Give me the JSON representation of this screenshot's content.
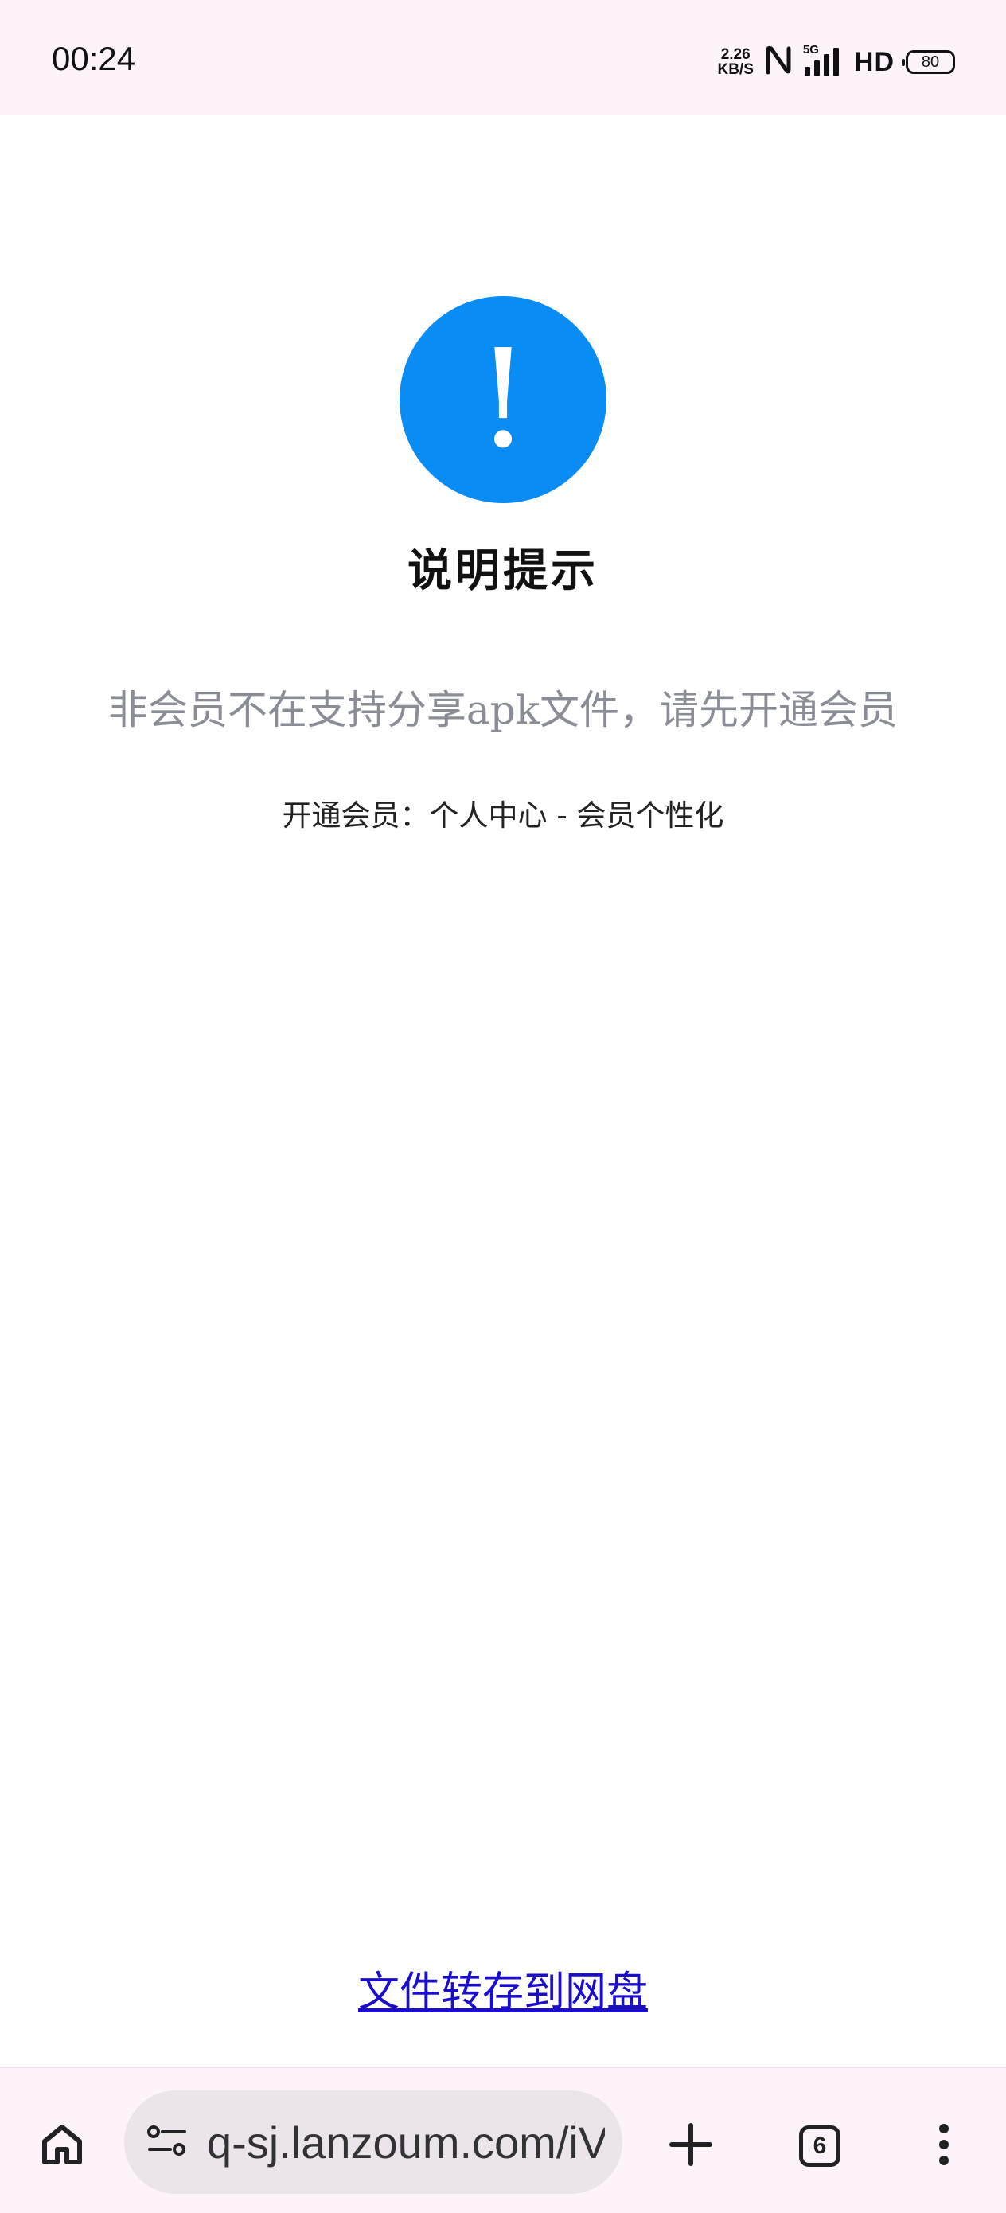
{
  "status_bar": {
    "time": "00:24",
    "net_speed_value": "2.26",
    "net_speed_unit": "KB/S",
    "network_label": "5G",
    "hd_label": "HD",
    "battery": "80"
  },
  "notice": {
    "icon_glyph": "!",
    "icon_color": "#0a8cf5",
    "title": "说明提示",
    "message": "非会员不在支持分享apk文件，请先开通会员",
    "sub_message": "开通会员：个人中心 - 会员个性化",
    "save_link_label": "文件转存到网盘"
  },
  "browser": {
    "url": "q-sj.lanzoum.com/iV",
    "tab_count": "6",
    "icons": [
      "home-icon",
      "site-settings-icon",
      "new-tab-icon",
      "tab-switcher-icon",
      "more-menu-icon"
    ]
  }
}
